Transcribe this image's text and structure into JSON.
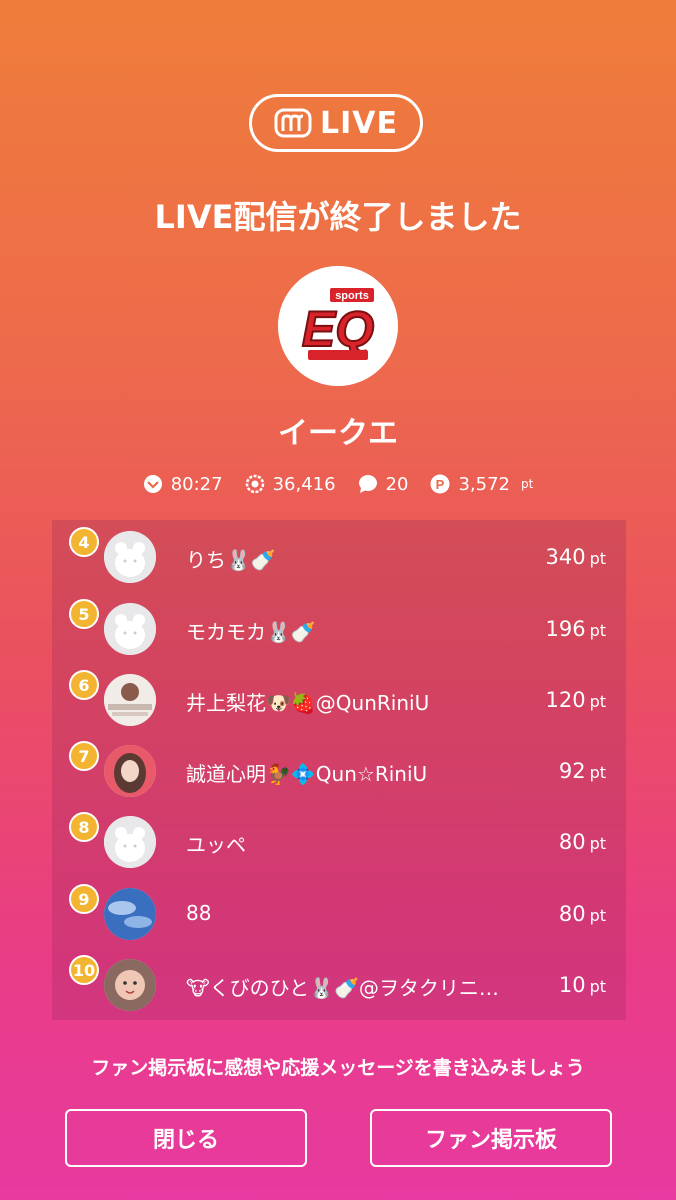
{
  "badge": {
    "label": "LIVE"
  },
  "title": "LIVE配信が終了しました",
  "channel": {
    "name": "イークエ",
    "logo_text": "sports",
    "logo_letters": "EQ"
  },
  "stats": [
    {
      "icon": "clock-icon",
      "value": "80:27"
    },
    {
      "icon": "viewers-icon",
      "value": "36,416"
    },
    {
      "icon": "comment-icon",
      "value": "20"
    },
    {
      "icon": "points-icon",
      "value": "3,572",
      "unit": "pt"
    }
  ],
  "ranking": [
    {
      "rank": "4",
      "name": "りち🐰🍼",
      "points": "340",
      "unit": "pt",
      "avatar": "default-bear"
    },
    {
      "rank": "5",
      "name": "モカモカ🐰🍼",
      "points": "196",
      "unit": "pt",
      "avatar": "default-bear"
    },
    {
      "rank": "6",
      "name": "井上梨花🐶🍓@QunRiniU",
      "points": "120",
      "unit": "pt",
      "avatar": "photo"
    },
    {
      "rank": "7",
      "name": "誠道心明🐓💠Qun☆RiniU",
      "points": "92",
      "unit": "pt",
      "avatar": "photo"
    },
    {
      "rank": "8",
      "name": "ユッペ",
      "points": "80",
      "unit": "pt",
      "avatar": "default-bear"
    },
    {
      "rank": "9",
      "name": "88",
      "points": "80",
      "unit": "pt",
      "avatar": "photo-sky"
    },
    {
      "rank": "10",
      "name": "🐮くびのひと🐰🍼@ヲタクリニ…",
      "points": "10",
      "unit": "pt",
      "avatar": "photo-child"
    }
  ],
  "footer": {
    "message": "ファン掲示板に感想や応援メッセージを書き込みましょう",
    "close_label": "閉じる",
    "board_label": "ファン掲示板"
  },
  "colors": {
    "rank_badge": "#f3b531",
    "gradient_top": "#ef7d3a",
    "gradient_bottom": "#e83aa0"
  }
}
